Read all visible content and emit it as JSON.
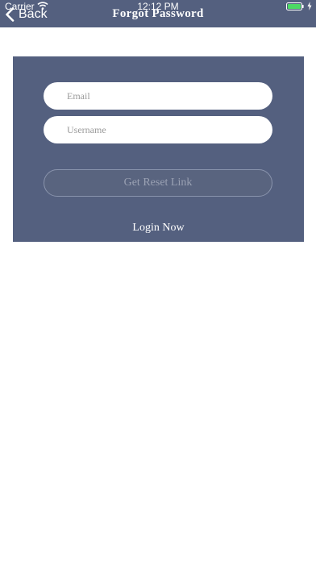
{
  "status_bar": {
    "carrier": "Carrier",
    "time": "12:12 PM",
    "wifi_icon": "wifi-icon",
    "battery_icon": "battery-icon",
    "charging_icon": "bolt-icon"
  },
  "nav_bar": {
    "back_label": "Back",
    "back_icon": "chevron-left-icon",
    "title": "Forgot Password"
  },
  "form": {
    "email": {
      "placeholder": "Email",
      "value": ""
    },
    "username": {
      "placeholder": "Username",
      "value": ""
    },
    "reset_button_label": "Get Reset Link",
    "login_link_label": "Login Now"
  },
  "colors": {
    "bar_background": "#54607f",
    "card_background": "#54607f",
    "page_background": "#ffffff",
    "battery_fill": "#4cd964"
  }
}
